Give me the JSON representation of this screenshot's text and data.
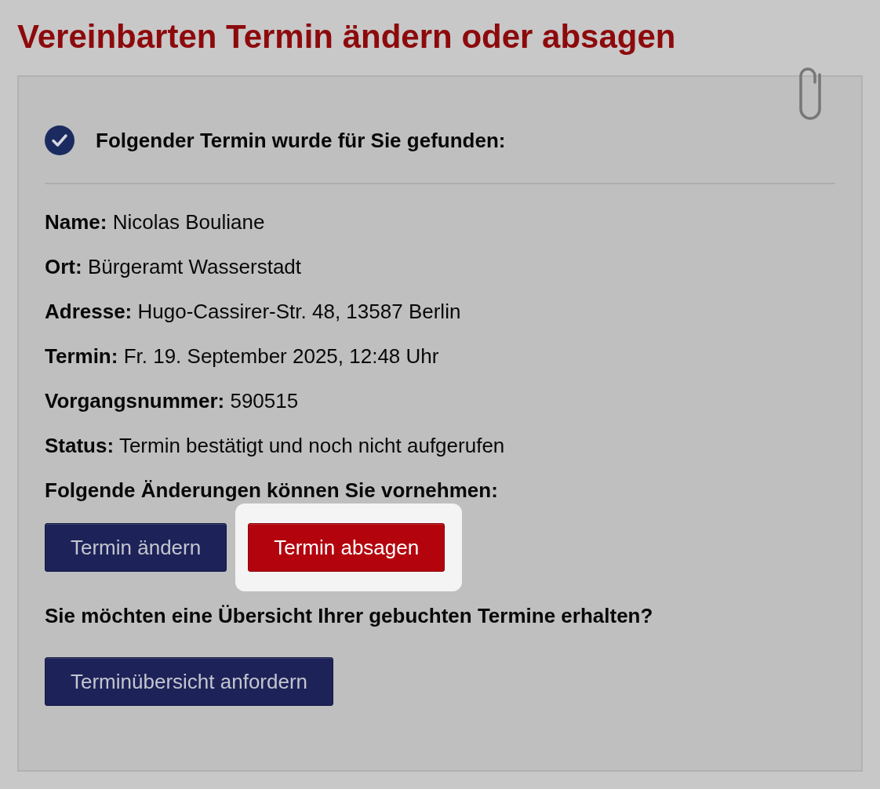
{
  "page": {
    "title": "Vereinbarten Termin ändern oder absagen"
  },
  "result": {
    "message": "Folgender Termin wurde für Sie gefunden:"
  },
  "details": [
    "**Name:** Nicolas Bouliane",
    "**Ort:** Bürgeramt Wasserstadt",
    "**Adresse:** Hugo-Cassirer-Str. 48, 13587 Berlin",
    "**Termin:** Fr. 19. September 2025, 12:48 Uhr",
    "**Vorgangsnummer:** 590515",
    "**Status:** Termin bestätigt und noch nicht aufgerufen"
  ],
  "changes": {
    "heading": "Folgende Änderungen können Sie vornehmen:",
    "buttons": [
      {
        "label": "Termin ändern",
        "kind": "primary",
        "highlighted": false
      },
      {
        "label": "Termin absagen",
        "kind": "danger",
        "highlighted": true
      }
    ]
  },
  "overview": {
    "question": "Sie möchten eine Übersicht Ihrer gebuchten Termine erhalten?",
    "buttons": [
      {
        "label": "Terminübersicht anfordern",
        "kind": "primary",
        "highlighted": false
      }
    ]
  }
}
